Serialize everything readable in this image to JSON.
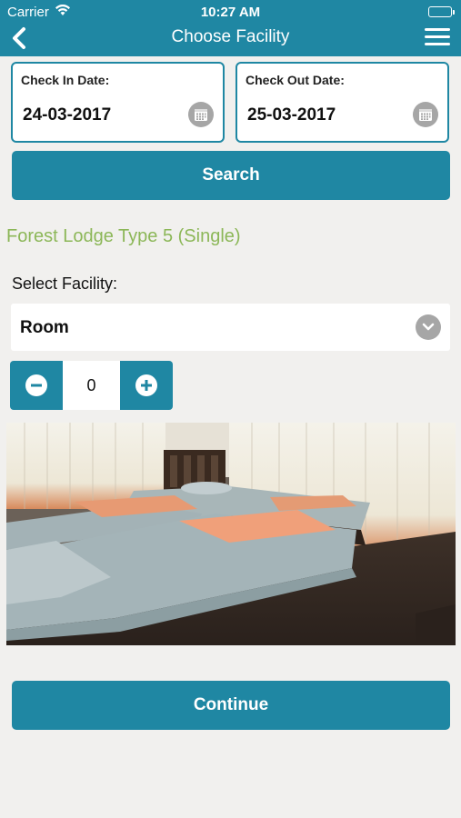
{
  "status_bar": {
    "carrier": "Carrier",
    "time": "10:27 AM"
  },
  "nav": {
    "title": "Choose Facility",
    "back_icon": "chevron-left-icon",
    "menu_icon": "hamburger-menu-icon"
  },
  "check_in": {
    "label": "Check In Date:",
    "value": "24-03-2017",
    "icon": "calendar-icon"
  },
  "check_out": {
    "label": "Check Out Date:",
    "value": "25-03-2017",
    "icon": "calendar-icon"
  },
  "search_button": "Search",
  "facility_name": "Forest Lodge Type 5 (Single)",
  "select_facility": {
    "label": "Select Facility:",
    "value": "Room",
    "icon": "chevron-down-icon"
  },
  "stepper": {
    "value": "0",
    "minus_icon": "minus-icon",
    "plus_icon": "plus-icon"
  },
  "photo": {
    "subject": "room-photo"
  },
  "continue_button": "Continue",
  "colors": {
    "primary": "#1f87a3",
    "facility_name": "#8cb758",
    "background": "#f1f0ee",
    "icon_gray": "#a6a6a6"
  }
}
